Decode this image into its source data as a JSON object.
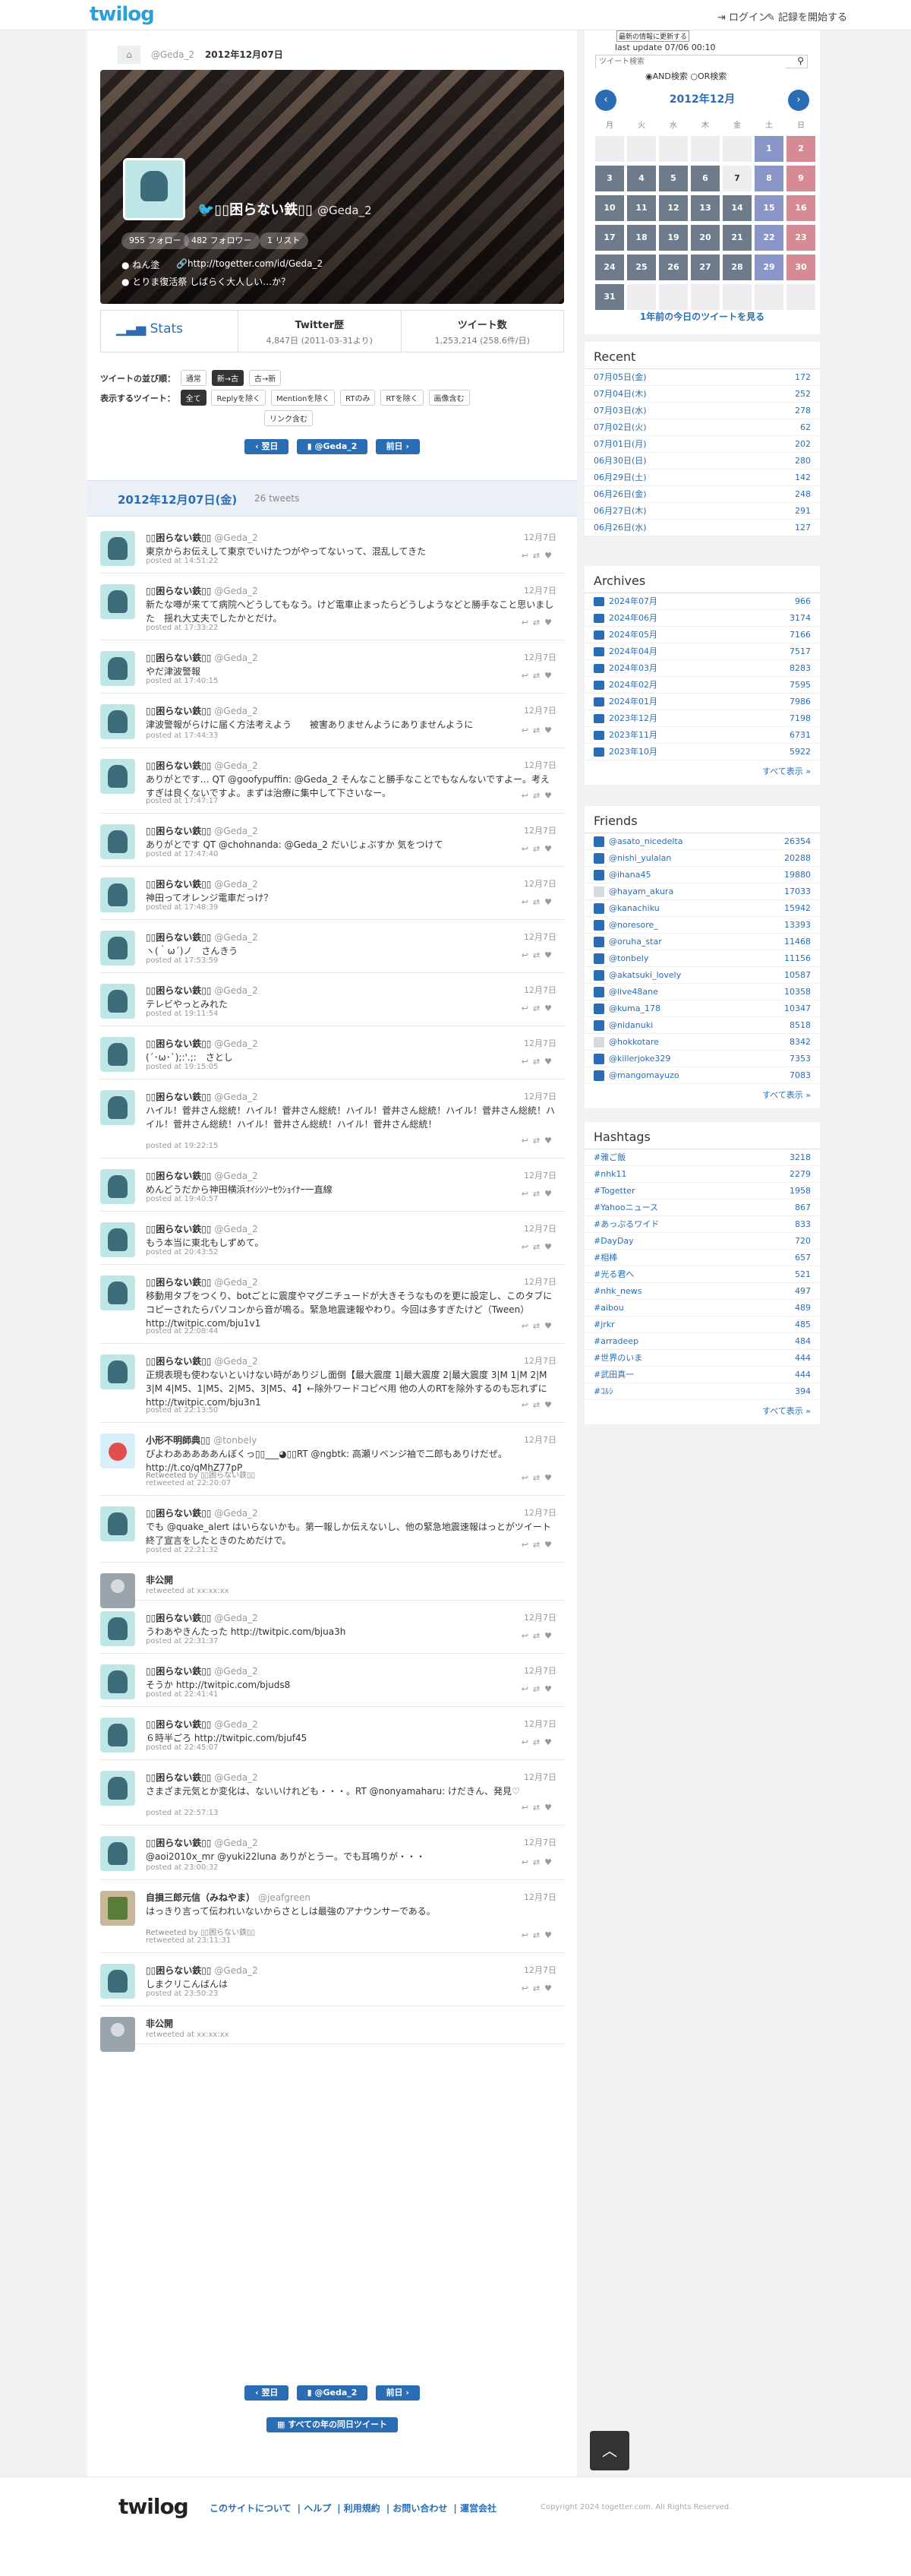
{
  "header": {
    "logo": "twilog",
    "login": "ログイン",
    "start": "記録を開始する"
  },
  "breadcrumb": {
    "user": "@Geda_2",
    "date": "2012年12月07日"
  },
  "profile": {
    "name": "▯▯困らない鉄▯▯",
    "screen": "@Geda_2",
    "follow": "955 フォロー",
    "follower": "482 フォロワー",
    "list": "1 リスト",
    "location": "ねん塗",
    "url": "http://togetter.com/id/Geda_2",
    "bio": "とりま復活祭 しばらく大人しい…か？"
  },
  "stats": {
    "label": "Stats",
    "h1": "Twitter歴",
    "v1": "4,847日 (2011-03-31より)",
    "h2": "ツイート数",
    "v2": "1,253,214 (258.6件/日)"
  },
  "options": {
    "order_label": "ツイートの並び順：",
    "order": [
      "通常",
      "新→古",
      "古→新"
    ],
    "show_label": "表示するツイート：",
    "show": [
      "全て",
      "Replyを除く",
      "Mentionを除く",
      "RTのみ",
      "RTを除く",
      "画像含む",
      "リンク含む"
    ]
  },
  "pager": {
    "prev": "翌日",
    "user": "@Geda_2",
    "next": "前日",
    "all": "すべての年の同日ツイート"
  },
  "day": {
    "title": "2012年12月07日(金)",
    "count": "26 tweets"
  },
  "tweets": [
    {
      "name": "▯▯困らない鉄▯▯",
      "sn": "@Geda_2",
      "date": "12月7日",
      "text": "東京からお伝えして東京でいけたつがやってないって、混乱してきた",
      "posted": "posted at 14:51:22"
    },
    {
      "name": "▯▯困らない鉄▯▯",
      "sn": "@Geda_2",
      "date": "12月7日",
      "text": "新たな噂が来てて病院へどうしてもなう。けど電車止まったらどうしようなどと勝手なこと思いました　揺れ大丈夫でしたかとだけ。",
      "posted": "posted at 17:33:22"
    },
    {
      "name": "▯▯困らない鉄▯▯",
      "sn": "@Geda_2",
      "date": "12月7日",
      "text": "やだ津波警報",
      "posted": "posted at 17:40:15"
    },
    {
      "name": "▯▯困らない鉄▯▯",
      "sn": "@Geda_2",
      "date": "12月7日",
      "text": "津波警報がらけに届く方法考えよう　　被害ありませんようにありませんように",
      "posted": "posted at 17:44:33"
    },
    {
      "name": "▯▯困らない鉄▯▯",
      "sn": "@Geda_2",
      "date": "12月7日",
      "text": "ありがとです… QT @goofypuffin: @Geda_2 そんなこと勝手なことでもなんないですよー。考えすぎは良くないですよ。まずは治療に集中して下さいなー。",
      "posted": "posted at 17:47:17"
    },
    {
      "name": "▯▯困らない鉄▯▯",
      "sn": "@Geda_2",
      "date": "12月7日",
      "text": "ありがとです QT @chohnanda: @Geda_2 だいじょぶすか 気をつけて",
      "posted": "posted at 17:47:40"
    },
    {
      "name": "▯▯困らない鉄▯▯",
      "sn": "@Geda_2",
      "date": "12月7日",
      "text": "神田ってオレンジ電車だっけ？",
      "posted": "posted at 17:48:39"
    },
    {
      "name": "▯▯困らない鉄▯▯",
      "sn": "@Geda_2",
      "date": "12月7日",
      "text": "ヽ(｀ω´)ノ　さんきう",
      "posted": "posted at 17:53:59"
    },
    {
      "name": "▯▯困らない鉄▯▯",
      "sn": "@Geda_2",
      "date": "12月7日",
      "text": "テレビやっとみれた",
      "posted": "posted at 19:11:54"
    },
    {
      "name": "▯▯困らない鉄▯▯",
      "sn": "@Geda_2",
      "date": "12月7日",
      "text": "(´･ω･`);:'.;:　さとし",
      "posted": "posted at 19:15:05"
    },
    {
      "name": "▯▯困らない鉄▯▯",
      "sn": "@Geda_2",
      "date": "12月7日",
      "text": "ハイル！菅井さん総統！ハイル！菅井さん総統！ハイル！菅井さん総統！ハイル！菅井さん総統！ハイル！菅井さん総統！ハイル！菅井さん総統！ハイル！菅井さん総統！",
      "posted": "posted at 19:22:15"
    },
    {
      "name": "▯▯困らない鉄▯▯",
      "sn": "@Geda_2",
      "date": "12月7日",
      "text": "めんどうだから神田横浜ｵｲｼｼｿｰｾｳｼｮｲﾅｰ一直線",
      "posted": "posted at 19:40:57"
    },
    {
      "name": "▯▯困らない鉄▯▯",
      "sn": "@Geda_2",
      "date": "12月7日",
      "text": "もう本当に東北もしずめて。",
      "posted": "posted at 20:43:52"
    },
    {
      "name": "▯▯困らない鉄▯▯",
      "sn": "@Geda_2",
      "date": "12月7日",
      "text": "移動用タブをつくり、botごとに震度やマグニチュードが大きそうなものを更に設定し、このタブにコピーされたらパソコンから音が鳴る。緊急地震速報やわり。今回は多すぎたけど（Tween）　http://twitpic.com/bju1v1",
      "posted": "posted at 22:08:44"
    },
    {
      "name": "▯▯困らない鉄▯▯",
      "sn": "@Geda_2",
      "date": "12月7日",
      "text": "正規表現も使わないといけない時がありジし面倒【最大震度 1|最大震度 2|最大震度 3|M 1|M 2|M 3|M 4|M5、1|M5、2|M5、3|M5、4】←除外ワードコピペ用 他の人のRTを除外するのも忘れずに　http://twitpic.com/bju3n1",
      "posted": "posted at 22:13:50"
    },
    {
      "name": "小形不明師典▯▯",
      "sn": "@tonbely",
      "date": "12月7日",
      "text": "ぴよわあああああんぼくっ▯▯___◕▯▯RT @ngbtk: 高瀬リベンジ袖で二郎もありけだぜ。　http://t.co/qMhZ77pP",
      "rt": "Retweeted by ▯▯困らない鉄▯▯",
      "posted": "retweeted at 22:20:07"
    },
    {
      "name": "▯▯困らない鉄▯▯",
      "sn": "@Geda_2",
      "date": "12月7日",
      "text": "でも @quake_alert はいらないかも。第一報しか伝えないし、他の緊急地震速報はっとがツイート終了宣言をしたときのためだけで。",
      "posted": "posted at 22:21:32"
    },
    {
      "name": "非公開",
      "sn": "",
      "date": "",
      "text": "",
      "posted": "retweeted at xx:xx:xx"
    },
    {
      "name": "▯▯困らない鉄▯▯",
      "sn": "@Geda_2",
      "date": "12月7日",
      "text": "うわあやきんたった http://twitpic.com/bjua3h",
      "posted": "posted at 22:31:37"
    },
    {
      "name": "▯▯困らない鉄▯▯",
      "sn": "@Geda_2",
      "date": "12月7日",
      "text": "そうか http://twitpic.com/bjuds8",
      "posted": "posted at 22:41:41"
    },
    {
      "name": "▯▯困らない鉄▯▯",
      "sn": "@Geda_2",
      "date": "12月7日",
      "text": "６時半ごろ http://twitpic.com/bjuf45",
      "posted": "posted at 22:45:07"
    },
    {
      "name": "▯▯困らない鉄▯▯",
      "sn": "@Geda_2",
      "date": "12月7日",
      "text": "さまざま元気とか変化は、ないいけれども・・・。RT @nonyamaharu: けだきん、発見♡",
      "posted": "posted at 22:57:13"
    },
    {
      "name": "▯▯困らない鉄▯▯",
      "sn": "@Geda_2",
      "date": "12月7日",
      "text": "@aoi2010x_mr @yuki22luna ありがとうー。でも耳鳴りが・・・",
      "posted": "posted at 23:00:32"
    },
    {
      "name": "自損三郎元信（みねやま）",
      "sn": "@jeafgreen",
      "date": "12月7日",
      "text": "はっきり言って伝われいないからさとしは最強のアナウンサーである。",
      "rt": "Retweeted by ▯▯困らない鉄▯▯",
      "posted": "retweeted at 23:11:31"
    },
    {
      "name": "▯▯困らない鉄▯▯",
      "sn": "@Geda_2",
      "date": "12月7日",
      "text": "しまクリこんばんは",
      "posted": "posted at 23:50:23"
    },
    {
      "name": "非公開",
      "sn": "",
      "date": "",
      "text": "",
      "posted": "retweeted at xx:xx:xx"
    }
  ],
  "calendar": {
    "search_placeholder": "ツイート検索",
    "latest": "最新の情報に更新する",
    "last_update": "last update 07/06 00:10",
    "and": "AND検索",
    "or": "OR検索",
    "month": "2012年12月",
    "days_hd": [
      "月",
      "火",
      "水",
      "木",
      "金",
      "土",
      "日"
    ],
    "oneyear": "1年前の今日のツイートを見る",
    "rows": [
      [
        "",
        "",
        "",
        "",
        "",
        "1",
        "2"
      ],
      [
        "3",
        "4",
        "5",
        "6",
        "7",
        "8",
        "9"
      ],
      [
        "10",
        "11",
        "12",
        "13",
        "14",
        "15",
        "16"
      ],
      [
        "17",
        "18",
        "19",
        "20",
        "21",
        "22",
        "23"
      ],
      [
        "24",
        "25",
        "26",
        "27",
        "28",
        "29",
        "30"
      ],
      [
        "31",
        "",
        "",
        "",
        "",
        "",
        ""
      ]
    ]
  },
  "recent": {
    "title": "Recent",
    "items": [
      [
        "07月05日(金)",
        "172"
      ],
      [
        "07月04日(木)",
        "252"
      ],
      [
        "07月03日(水)",
        "278"
      ],
      [
        "07月02日(火)",
        "62"
      ],
      [
        "07月01日(月)",
        "202"
      ],
      [
        "06月30日(日)",
        "280"
      ],
      [
        "06月29日(土)",
        "142"
      ],
      [
        "06月26日(金)",
        "248"
      ],
      [
        "06月27日(木)",
        "291"
      ],
      [
        "06月26日(水)",
        "127"
      ]
    ]
  },
  "archives": {
    "title": "Archives",
    "items": [
      [
        "2024年07月",
        "966"
      ],
      [
        "2024年06月",
        "3174"
      ],
      [
        "2024年05月",
        "7166"
      ],
      [
        "2024年04月",
        "7517"
      ],
      [
        "2024年03月",
        "8283"
      ],
      [
        "2024年02月",
        "7595"
      ],
      [
        "2024年01月",
        "7986"
      ],
      [
        "2023年12月",
        "7198"
      ],
      [
        "2023年11月",
        "6731"
      ],
      [
        "2023年10月",
        "5922"
      ]
    ],
    "more": "すべて表示 »"
  },
  "friends": {
    "title": "Friends",
    "items": [
      [
        "@asato_nicedelta",
        "26354"
      ],
      [
        "@nishi_yulalan",
        "20288"
      ],
      [
        "@ihana45",
        "19880"
      ],
      [
        "@hayam_akura",
        "17033"
      ],
      [
        "@kanachiku",
        "15942"
      ],
      [
        "@noresore_",
        "13393"
      ],
      [
        "@oruha_star",
        "11468"
      ],
      [
        "@tonbely",
        "11156"
      ],
      [
        "@akatsuki_lovely",
        "10587"
      ],
      [
        "@live48ane",
        "10358"
      ],
      [
        "@kuma_178",
        "10347"
      ],
      [
        "@nidanuki",
        "8518"
      ],
      [
        "@hokkotare",
        "8342"
      ],
      [
        "@killerjoke329",
        "7353"
      ],
      [
        "@mangomayuzo",
        "7083"
      ]
    ],
    "more": "すべて表示 »"
  },
  "hashtags": {
    "title": "Hashtags",
    "items": [
      [
        "#雅ご飯",
        "3218"
      ],
      [
        "#nhk11",
        "2279"
      ],
      [
        "#Togetter",
        "1958"
      ],
      [
        "#Yahooニュース",
        "867"
      ],
      [
        "#あっぷるワイド",
        "833"
      ],
      [
        "#DayDay",
        "720"
      ],
      [
        "#相棒",
        "657"
      ],
      [
        "#光る君へ",
        "521"
      ],
      [
        "#nhk_news",
        "497"
      ],
      [
        "#aibou",
        "489"
      ],
      [
        "#jrkr",
        "485"
      ],
      [
        "#arradeep",
        "484"
      ],
      [
        "#世界のいま",
        "444"
      ],
      [
        "#武田真一",
        "444"
      ],
      [
        "#ｺﾙｼ",
        "394"
      ]
    ],
    "more": "すべて表示 »"
  },
  "footer": {
    "logo": "twilog",
    "links": [
      "このサイトについて",
      "ヘルプ",
      "利用規約",
      "お問い合わせ",
      "運営会社"
    ],
    "copy": "Copyright 2024 togetter.com. All Rights Reserved."
  }
}
